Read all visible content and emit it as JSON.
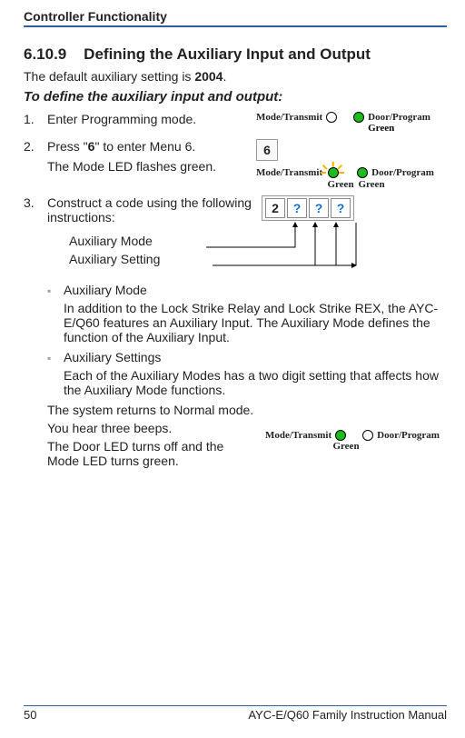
{
  "header": {
    "running_head": "Controller Functionality"
  },
  "section": {
    "number": "6.10.9",
    "title": "Defining the Auxiliary Input and Output",
    "intro_prefix": "The default auxiliary setting is ",
    "intro_value": "2004",
    "intro_suffix": ".",
    "subhead": "To define the auxiliary input and output:"
  },
  "steps": {
    "s1": {
      "num": "1.",
      "text": "Enter Programming mode."
    },
    "s2": {
      "num": "2.",
      "text_a": "Press \"",
      "key": "6",
      "text_b": "\" to enter Menu 6.",
      "note": "The Mode LED flashes green."
    },
    "s3": {
      "num": "3.",
      "text": "Construct a code using the following instructions:",
      "label_mode": "Auxiliary Mode",
      "label_setting": "Auxiliary Setting",
      "cells": [
        "2",
        "?",
        "?",
        "?"
      ]
    }
  },
  "bullets": {
    "b1": {
      "title": "Auxiliary Mode",
      "para": "In addition to the Lock Strike Relay and Lock Strike REX, the AYC-E/Q60 features an Auxiliary Input. The Auxiliary Mode defines the function of the Auxiliary Input."
    },
    "b2": {
      "title": "Auxiliary Settings",
      "para": "Each of the Auxiliary Modes has a two digit setting that affects how the Auxiliary Mode functions."
    }
  },
  "final": {
    "p1": "The system returns to Normal mode.",
    "p2": "You hear three beeps.",
    "p3": "The Door LED turns off and the Mode LED turns green."
  },
  "led_labels": {
    "mode": "Mode/Transmit",
    "door": "Door/Program",
    "green": "Green"
  },
  "footer": {
    "page": "50",
    "manual": "AYC-E/Q60 Family Instruction Manual"
  }
}
